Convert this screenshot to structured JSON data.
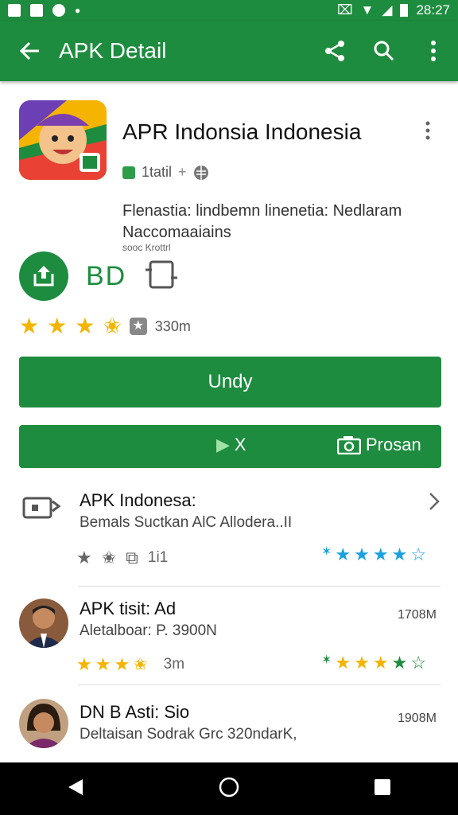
{
  "status": {
    "time": "28:27"
  },
  "appbar": {
    "title": "APK Detail",
    "back_icon": "arrow-left-icon",
    "share_icon": "share-icon",
    "search_icon": "search-icon",
    "more_icon": "more-vert-icon"
  },
  "app": {
    "name": "APR Indonsia Indonesia",
    "verified_label": "1tatil",
    "description": "Flenastia: lindbemn linenetia: Nedlaram Naccomaaiains",
    "small_text": "sooc Krottrl",
    "rating_count": "330m"
  },
  "actions": {
    "icon_label": "BD"
  },
  "buttons": {
    "primary": "Undy",
    "secondary_right": "Prosan",
    "secondary_mid": "X"
  },
  "list": [
    {
      "title": "APK Indonesa:",
      "subtitle": "Bemals Suctkan AlC Allodera..II",
      "meta": "1i1"
    },
    {
      "title": "APK tisit: Ad",
      "subtitle": "Aletalboar: P. 3900N",
      "size": "1708M",
      "meta": "3m"
    },
    {
      "title": "DN B Asti: Sio",
      "subtitle": "Deltaisan Sodrak Grc 320ndarK,",
      "size": "1908M"
    }
  ],
  "colors": {
    "primary": "#1e8c3f",
    "star": "#f4b400",
    "blue_star": "#1aa1e0"
  }
}
